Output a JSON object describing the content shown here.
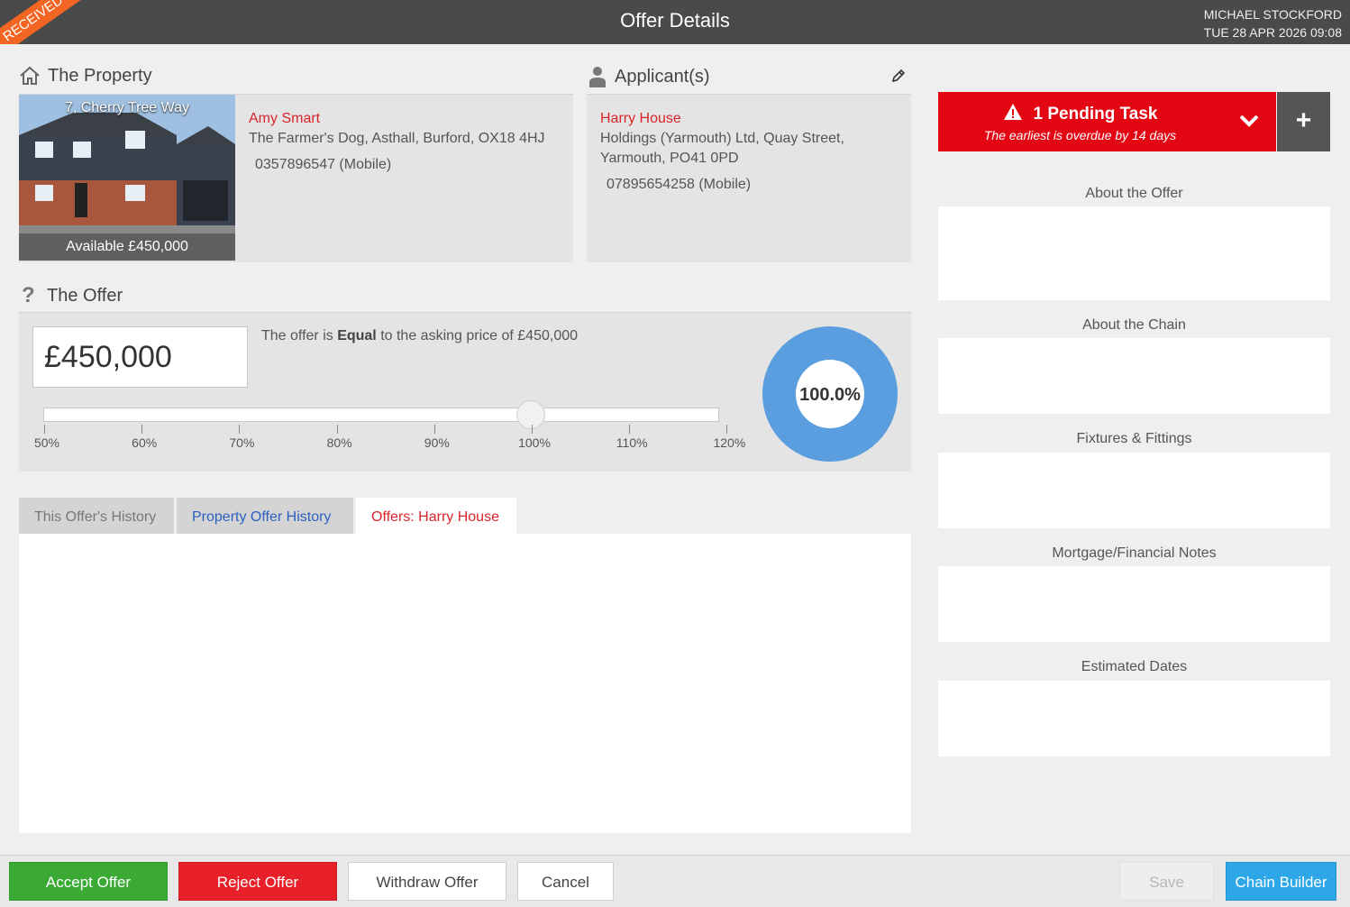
{
  "header": {
    "title": "Offer Details",
    "user_name": "MICHAEL STOCKFORD",
    "datetime": "TUE 28 APR 2026 09:08",
    "status_ribbon": "RECEIVED"
  },
  "property": {
    "section_title": "The Property",
    "address": "7, Cherry Tree Way",
    "availability": "Available £450,000",
    "contact_name": "Amy Smart",
    "contact_address": "The Farmer's Dog, Asthall, Burford, OX18 4HJ",
    "contact_phone": "0357896547 (Mobile)"
  },
  "applicants": {
    "section_title": "Applicant(s)",
    "name": "Harry House",
    "address_line1": "Holdings (Yarmouth) Ltd, Quay Street,",
    "address_line2": "Yarmouth, PO41 0PD",
    "phone": "07895654258 (Mobile)"
  },
  "offer": {
    "section_title": "The Offer",
    "amount": "£450,000",
    "comparison_prefix": "The offer is ",
    "comparison_word": "Equal",
    "comparison_suffix": " to the asking price of £450,000",
    "slider_value_percent": 100,
    "slider_ticks": [
      "50%",
      "60%",
      "70%",
      "80%",
      "90%",
      "100%",
      "110%",
      "120%"
    ],
    "donut_label": "100.0%",
    "donut_fraction": 1.0
  },
  "tabs": [
    {
      "label": "This Offer's History"
    },
    {
      "label": "Property Offer History"
    },
    {
      "label": "Offers: Harry House"
    }
  ],
  "pending": {
    "title": "1 Pending Task",
    "subtitle": "The earliest is overdue by 14 days"
  },
  "side_sections": [
    {
      "label": "About the Offer"
    },
    {
      "label": "About the Chain"
    },
    {
      "label": "Fixtures & Fittings"
    },
    {
      "label": "Mortgage/Financial Notes"
    },
    {
      "label": "Estimated Dates"
    }
  ],
  "footer": {
    "accept": "Accept Offer",
    "reject": "Reject Offer",
    "withdraw": "Withdraw Offer",
    "cancel": "Cancel",
    "save": "Save",
    "chain_builder": "Chain Builder"
  },
  "colors": {
    "topbar": "#4a4a4a",
    "ribbon": "#f26522",
    "accent_red": "#d9262c",
    "pending_red": "#e30613",
    "donut_blue": "#5a9ee0",
    "accept_green": "#3aaa35",
    "chain_blue": "#2ea7e8"
  }
}
